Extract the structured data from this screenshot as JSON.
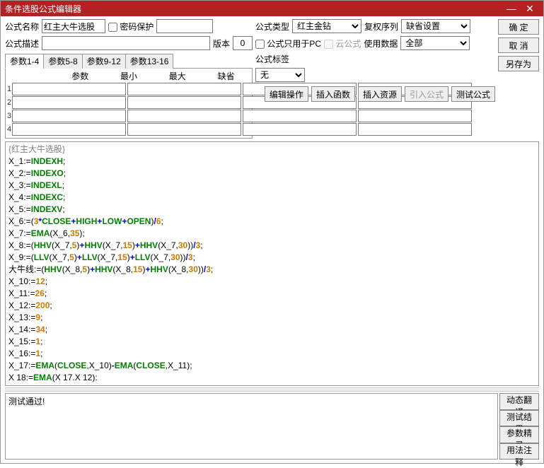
{
  "title": "条件选股公式编辑器",
  "win": {
    "min": "—",
    "close": "✕"
  },
  "labels": {
    "name": "公式名称",
    "pwd": "密码保护",
    "desc": "公式描述",
    "ver": "版本",
    "type": "公式类型",
    "restore": "复权序列",
    "pcOnly": "公式只用于PC",
    "cloud": "云公式",
    "useData": "使用数据",
    "tag": "公式标签"
  },
  "values": {
    "name": "红主大牛选股",
    "desc": "",
    "ver": "0",
    "type": "红主金钻",
    "restore": "缺省设置",
    "useData": "全部",
    "tag": "无",
    "pwd": ""
  },
  "buttons": {
    "ok": "确 定",
    "cancel": "取 消",
    "saveAs": "另存为",
    "editOp": "编辑操作",
    "insFunc": "插入函数",
    "insRes": "插入资源",
    "impFormula": "引入公式",
    "test": "测试公式"
  },
  "paramTabs": [
    "参数1-4",
    "参数5-8",
    "参数9-12",
    "参数13-16"
  ],
  "paramHead": [
    "参数",
    "最小",
    "最大",
    "缺省"
  ],
  "paramRows": [
    1,
    2,
    3,
    4
  ],
  "status": "测试通过!",
  "sideBtns": [
    "动态翻译",
    "测试结果",
    "参数精灵",
    "用法注释"
  ],
  "code": {
    "guard": "{红主大牛选股}",
    "lines": [
      {
        "v": "X_1",
        "f": "INDEXH"
      },
      {
        "v": "X_2",
        "f": "INDEXO"
      },
      {
        "v": "X_3",
        "f": "INDEXL"
      },
      {
        "v": "X_4",
        "f": "INDEXC"
      },
      {
        "v": "X_5",
        "f": "INDEXV"
      }
    ],
    "x6": {
      "v": "X_6",
      "a": "3",
      "b": "CLOSE",
      "c": "HIGH",
      "d": "LOW",
      "e": "OPEN",
      "div": "6"
    },
    "x7": {
      "v": "X_7",
      "f": "EMA",
      "arg": "X_6",
      "n": "35"
    },
    "x8": {
      "v": "X_8",
      "f1": "HHV",
      "a1": "X_7",
      "n1": "5",
      "a2": "X_7",
      "n2": "15",
      "a3": "X_7",
      "n3": "30",
      "div": "3"
    },
    "x9": {
      "v": "X_9",
      "f1": "LLV",
      "a1": "X_7",
      "n1": "5",
      "a2": "X_7",
      "n2": "15",
      "a3": "X_7",
      "n3": "30",
      "div": "3"
    },
    "dn": {
      "v": "大牛线",
      "f1": "HHV",
      "a1": "X_8",
      "n1": "5",
      "a2": "X_8",
      "n2": "15",
      "a3": "X_8",
      "n3": "30",
      "div": "3"
    },
    "consts": [
      {
        "v": "X_10",
        "n": "12"
      },
      {
        "v": "X_11",
        "n": "26"
      },
      {
        "v": "X_12",
        "n": "200"
      },
      {
        "v": "X_13",
        "n": "9"
      },
      {
        "v": "X_14",
        "n": "34"
      },
      {
        "v": "X_15",
        "n": "1"
      },
      {
        "v": "X_16",
        "n": "1"
      }
    ],
    "x17": {
      "v": "X_17",
      "f": "EMA",
      "a": "CLOSE",
      "b": "X_10",
      "c": "CLOSE",
      "d": "X_11"
    },
    "x18": {
      "v": "X 18",
      "f": "EMA",
      "a": "X 17",
      "b": "X 12"
    }
  }
}
